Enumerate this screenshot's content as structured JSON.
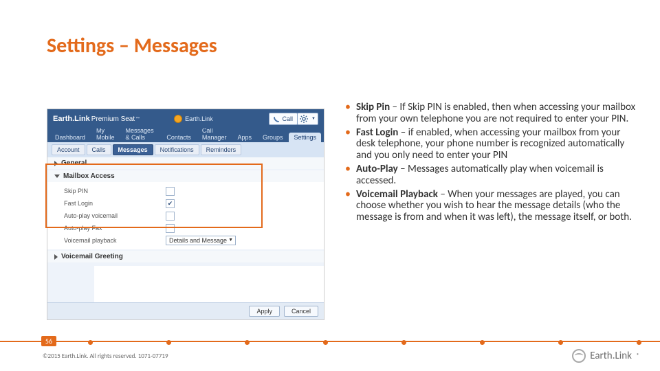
{
  "title": "Settings – Messages",
  "shot": {
    "brand_bold": "Earth.Link",
    "brand_light": "Premium Seat",
    "elink": "Earth.Link",
    "buttons": {
      "call": "Call",
      "apply": "Apply",
      "cancel": "Cancel"
    },
    "main_tabs": [
      "Dashboard",
      "My Mobile",
      "Messages & Calls",
      "Contacts",
      "Call Manager",
      "Apps",
      "Groups",
      "Settings"
    ],
    "sub_tabs": [
      "Account",
      "Calls",
      "Messages",
      "Notifications",
      "Reminders"
    ],
    "sections": {
      "general": "General",
      "mailbox": "Mailbox Access",
      "voicemail": "Voicemail Greeting"
    },
    "options": {
      "skip_pin": "Skip PIN",
      "fast_login": "Fast Login",
      "autoplay_vm": "Auto-play voicemail",
      "autoplay_fax": "Auto-play Fax",
      "vm_playback": "Voicemail playback",
      "vm_playback_value": "Details and Message"
    }
  },
  "bullets": [
    {
      "term": "Skip Pin",
      "body": " – If Skip PIN is enabled, then when accessing your mailbox from your own telephone you are not required to enter your PIN."
    },
    {
      "term": "Fast Login",
      "body": " – if enabled, when accessing your mailbox from your desk telephone, your phone number is recognized automatically and you only need to enter your PIN"
    },
    {
      "term": "Auto-Play",
      "body": " – Messages automatically play when voicemail is accessed."
    },
    {
      "term": "Voicemail Playback",
      "body": " – When your messages are played, you can choose whether you wish to hear the message details (who the message is from and when it was left), the message itself, or both."
    }
  ],
  "footer": {
    "page": "56",
    "copyright": "©2015 Earth.Link. All rights reserved. 1071-07719",
    "logo_text": "Earth.Link"
  }
}
